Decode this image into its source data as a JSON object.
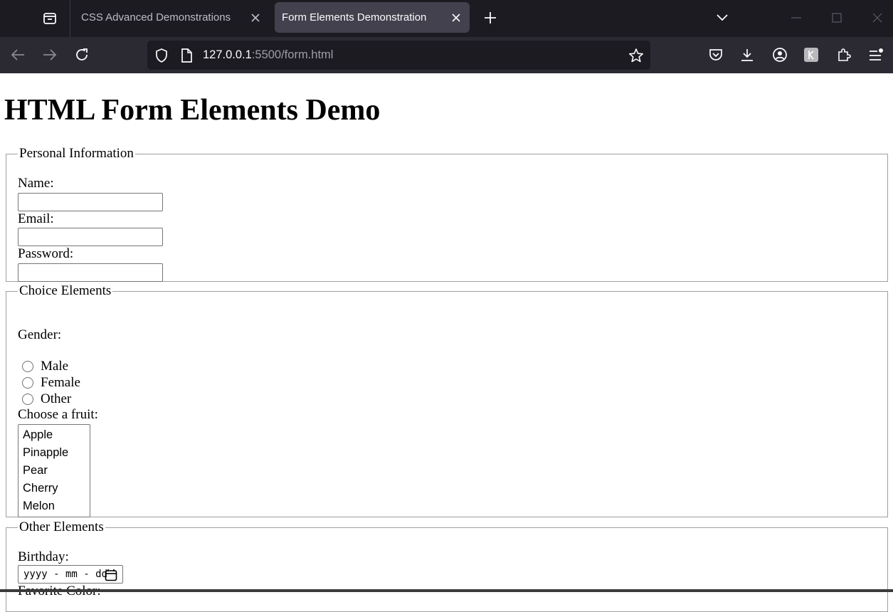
{
  "browser": {
    "tabs": [
      {
        "title": "CSS Advanced Demonstrations",
        "active": false
      },
      {
        "title": "Form Elements Demonstration",
        "active": true
      }
    ],
    "url": {
      "host": "127.0.0.1",
      "path": ":5500/form.html"
    }
  },
  "page": {
    "title": "HTML Form Elements Demo",
    "personal": {
      "legend": "Personal Information",
      "name_label": "Name:",
      "email_label": "Email:",
      "password_label": "Password:"
    },
    "choice": {
      "legend": "Choice Elements",
      "gender_label": "Gender:",
      "gender_options": [
        "Male",
        "Female",
        "Other"
      ],
      "fruit_label": "Choose a fruit:",
      "fruits": [
        "Apple",
        "Pinapple",
        "Pear",
        "Cherry",
        "Melon"
      ]
    },
    "other": {
      "legend": "Other Elements",
      "birthday_label": "Birthday:",
      "birthday_placeholder": "yyyy - mm - dd",
      "color_label": "Favorite Color:"
    }
  },
  "colors": {
    "tabbar_bg": "#1c1b22",
    "navbar_bg": "#2b2a33",
    "active_tab_bg": "#42414d",
    "urlbar_bg": "#1c1b22"
  }
}
